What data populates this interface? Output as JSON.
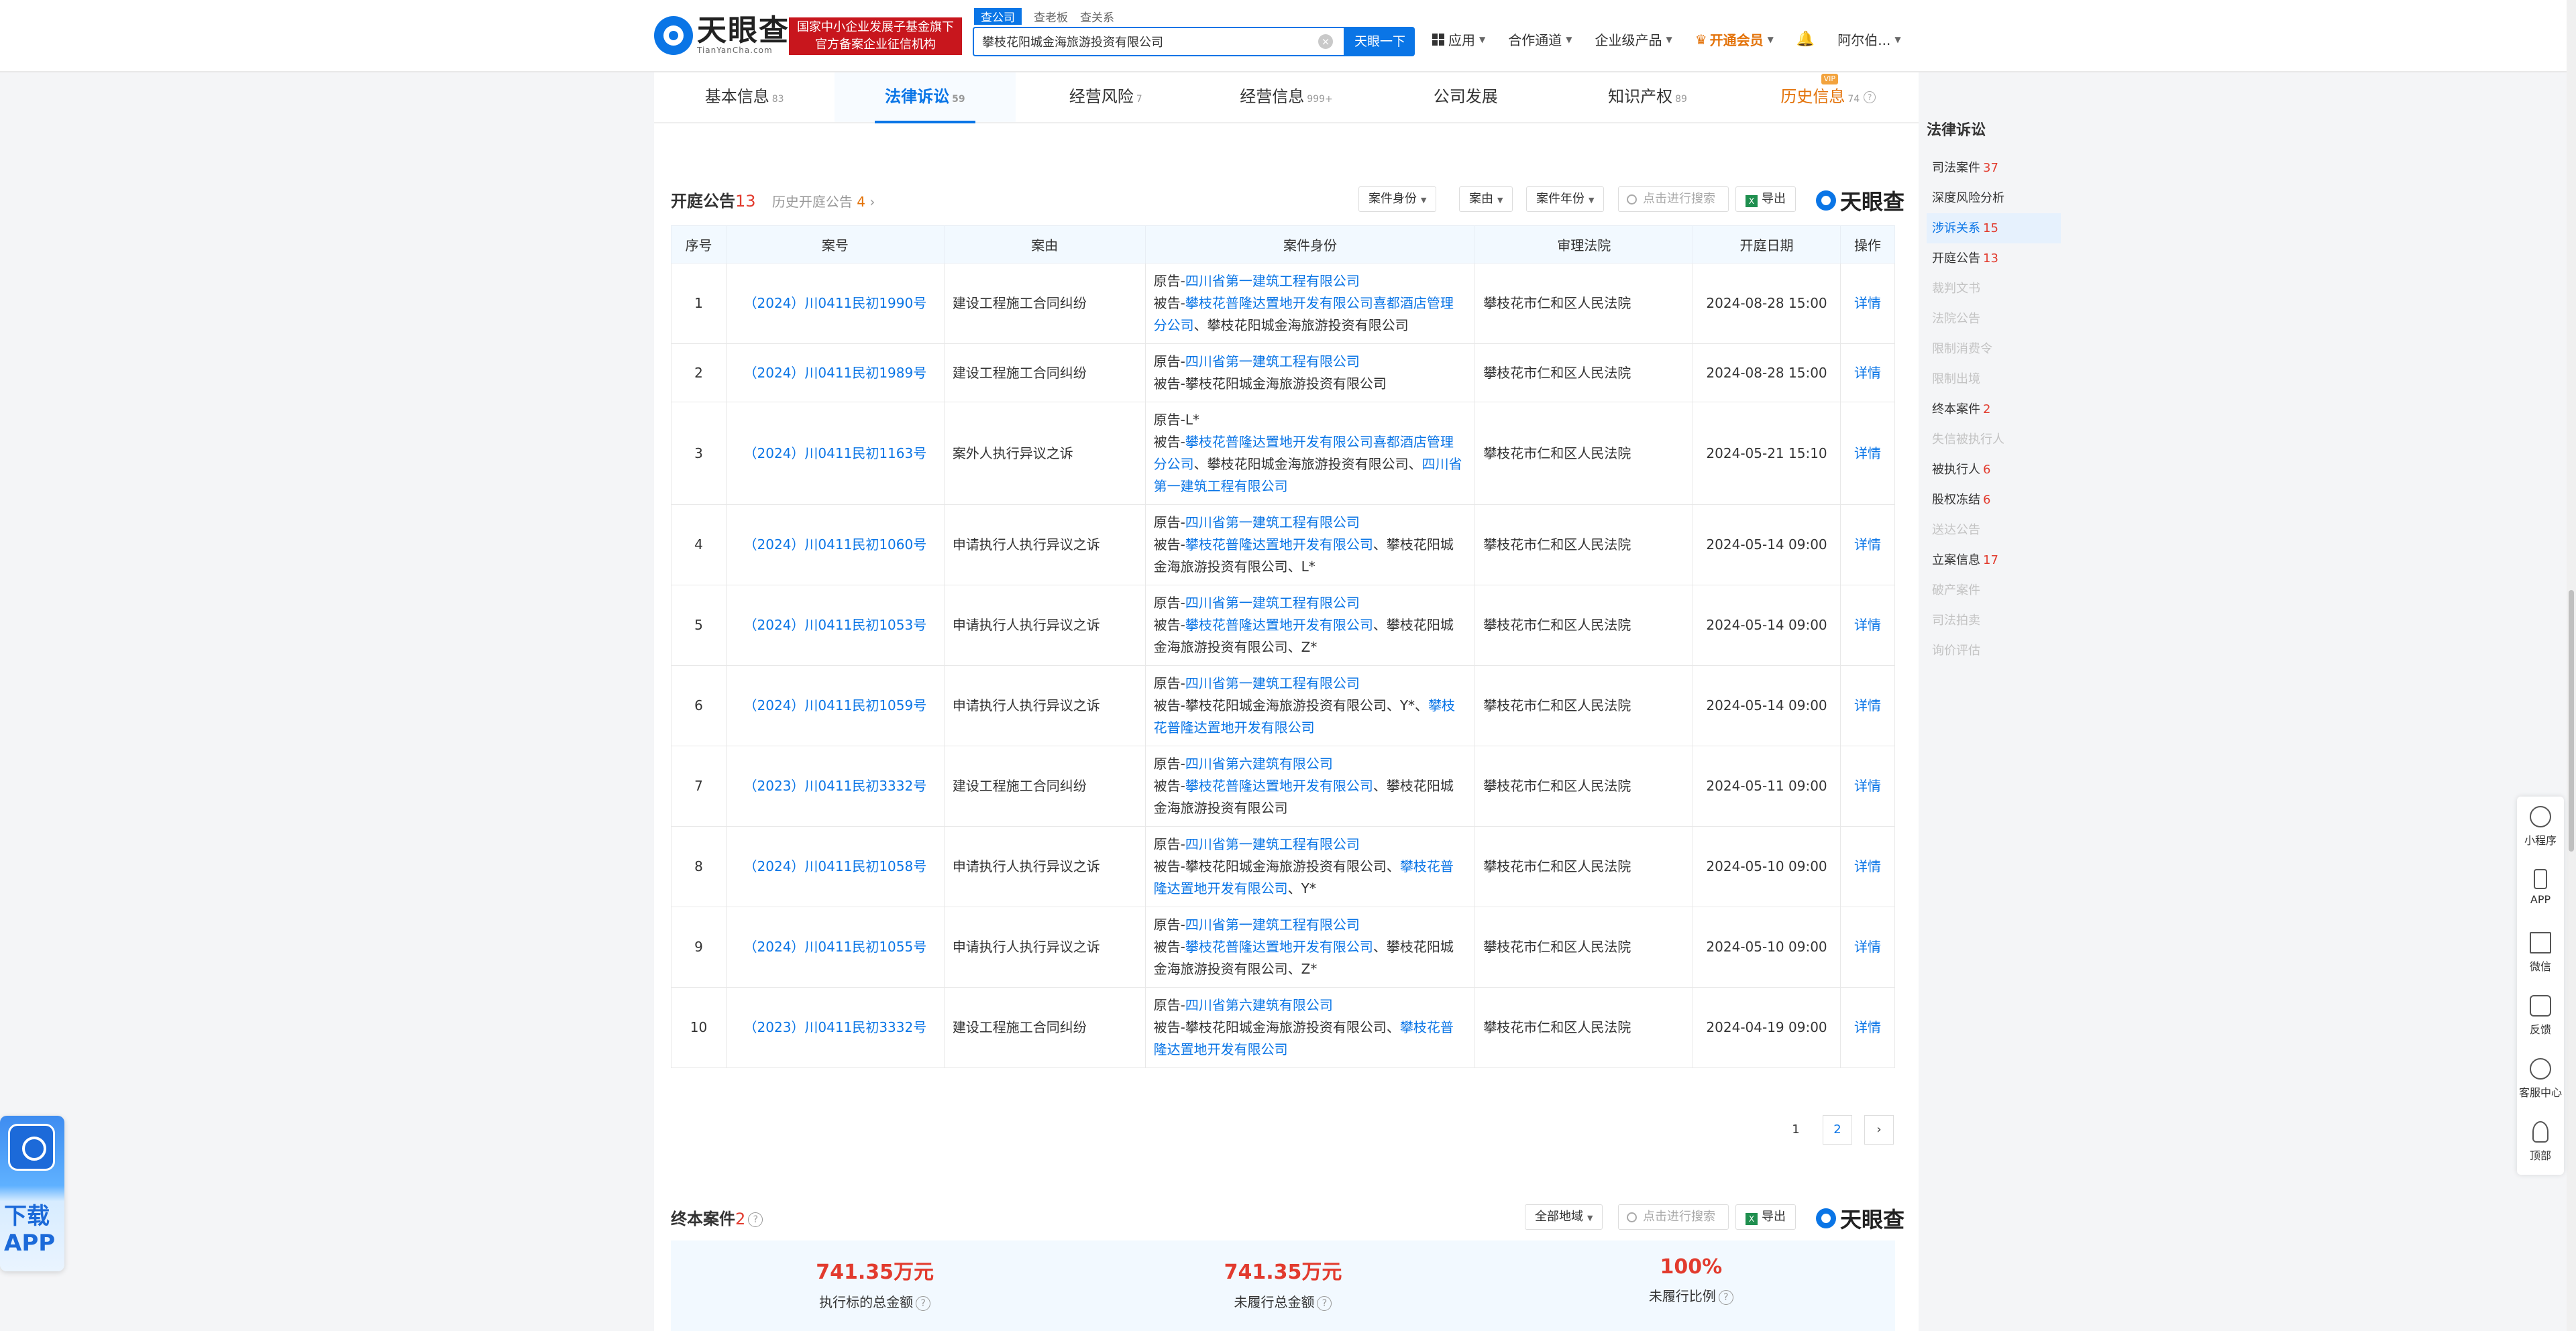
{
  "header": {
    "logo_cn": "天眼查",
    "logo_en": "TianYanCha.com",
    "badge_line1": "国家中小企业发展子基金旗下",
    "badge_line2": "官方备案企业征信机构",
    "search_tabs": [
      "查公司",
      "查老板",
      "查关系"
    ],
    "search_value": "攀枝花阳城金海旅游投资有限公司",
    "search_button": "天眼一下",
    "nav": {
      "apps": "应用",
      "channel": "合作通道",
      "enterprise": "企业级产品",
      "vip": "开通会员",
      "user": "阿尔伯..."
    }
  },
  "tabs": [
    {
      "label": "基本信息",
      "count": "83"
    },
    {
      "label": "法律诉讼",
      "count": "59"
    },
    {
      "label": "经营风险",
      "count": "7"
    },
    {
      "label": "经营信息",
      "count": "999+"
    },
    {
      "label": "公司发展",
      "count": ""
    },
    {
      "label": "知识产权",
      "count": "89"
    },
    {
      "label": "历史信息",
      "count": "74",
      "tag": "VIP"
    }
  ],
  "court": {
    "title": "开庭公告",
    "count": "13",
    "history_label": "历史开庭公告",
    "history_count": "4",
    "filters": [
      "案件身份",
      "案由",
      "案件年份"
    ],
    "search_placeholder": "点击进行搜索",
    "export": "导出",
    "brand": "天眼查",
    "columns": [
      "序号",
      "案号",
      "案由",
      "案件身份",
      "审理法院",
      "开庭日期",
      "操作"
    ],
    "rows": [
      {
        "no": "1",
        "case": "（2024）川0411民初1990号",
        "reason": "建设工程施工合同纠纷",
        "plaintiff": "四川省第一建筑工程有限公司",
        "defendant": [
          {
            "t": "攀枝花普隆达置地开发有限公司喜都酒店管理分公司",
            "link": true
          },
          {
            "t": "、攀枝花阳城金海旅游投资有限公司",
            "link": false
          }
        ],
        "court": "攀枝花市仁和区人民法院",
        "date": "2024-08-28 15:00",
        "op": "详情"
      },
      {
        "no": "2",
        "case": "（2024）川0411民初1989号",
        "reason": "建设工程施工合同纠纷",
        "plaintiff": "四川省第一建筑工程有限公司",
        "defendant": [
          {
            "t": "攀枝花阳城金海旅游投资有限公司",
            "link": false
          }
        ],
        "court": "攀枝花市仁和区人民法院",
        "date": "2024-08-28 15:00",
        "op": "详情"
      },
      {
        "no": "3",
        "case": "（2024）川0411民初1163号",
        "reason": "案外人执行异议之诉",
        "plaintiff_plain": "L*",
        "defendant": [
          {
            "t": "攀枝花普隆达置地开发有限公司喜都酒店管理分公司",
            "link": true
          },
          {
            "t": "、攀枝花阳城金海旅游投资有限公司、",
            "link": false
          },
          {
            "t": "四川省第一建筑工程有限公司",
            "link": true
          }
        ],
        "court": "攀枝花市仁和区人民法院",
        "date": "2024-05-21 15:10",
        "op": "详情"
      },
      {
        "no": "4",
        "case": "（2024）川0411民初1060号",
        "reason": "申请执行人执行异议之诉",
        "plaintiff": "四川省第一建筑工程有限公司",
        "defendant": [
          {
            "t": "攀枝花普隆达置地开发有限公司",
            "link": true
          },
          {
            "t": "、攀枝花阳城金海旅游投资有限公司、L*",
            "link": false
          }
        ],
        "court": "攀枝花市仁和区人民法院",
        "date": "2024-05-14 09:00",
        "op": "详情"
      },
      {
        "no": "5",
        "case": "（2024）川0411民初1053号",
        "reason": "申请执行人执行异议之诉",
        "plaintiff": "四川省第一建筑工程有限公司",
        "defendant": [
          {
            "t": "攀枝花普隆达置地开发有限公司",
            "link": true
          },
          {
            "t": "、攀枝花阳城金海旅游投资有限公司、Z*",
            "link": false
          }
        ],
        "court": "攀枝花市仁和区人民法院",
        "date": "2024-05-14 09:00",
        "op": "详情"
      },
      {
        "no": "6",
        "case": "（2024）川0411民初1059号",
        "reason": "申请执行人执行异议之诉",
        "plaintiff": "四川省第一建筑工程有限公司",
        "defendant": [
          {
            "t": "攀枝花阳城金海旅游投资有限公司、Y*、",
            "link": false
          },
          {
            "t": "攀枝花普隆达置地开发有限公司",
            "link": true
          }
        ],
        "court": "攀枝花市仁和区人民法院",
        "date": "2024-05-14 09:00",
        "op": "详情"
      },
      {
        "no": "7",
        "case": "（2023）川0411民初3332号",
        "reason": "建设工程施工合同纠纷",
        "plaintiff": "四川省第六建筑有限公司",
        "defendant": [
          {
            "t": "攀枝花普隆达置地开发有限公司",
            "link": true
          },
          {
            "t": "、攀枝花阳城金海旅游投资有限公司",
            "link": false
          }
        ],
        "court": "攀枝花市仁和区人民法院",
        "date": "2024-05-11 09:00",
        "op": "详情"
      },
      {
        "no": "8",
        "case": "（2024）川0411民初1058号",
        "reason": "申请执行人执行异议之诉",
        "plaintiff": "四川省第一建筑工程有限公司",
        "defendant": [
          {
            "t": "攀枝花阳城金海旅游投资有限公司、",
            "link": false
          },
          {
            "t": "攀枝花普隆达置地开发有限公司",
            "link": true
          },
          {
            "t": "、Y*",
            "link": false
          }
        ],
        "court": "攀枝花市仁和区人民法院",
        "date": "2024-05-10 09:00",
        "op": "详情"
      },
      {
        "no": "9",
        "case": "（2024）川0411民初1055号",
        "reason": "申请执行人执行异议之诉",
        "plaintiff": "四川省第一建筑工程有限公司",
        "defendant": [
          {
            "t": "攀枝花普隆达置地开发有限公司",
            "link": true
          },
          {
            "t": "、攀枝花阳城金海旅游投资有限公司、Z*",
            "link": false
          }
        ],
        "court": "攀枝花市仁和区人民法院",
        "date": "2024-05-10 09:00",
        "op": "详情"
      },
      {
        "no": "10",
        "case": "（2023）川0411民初3332号",
        "reason": "建设工程施工合同纠纷",
        "plaintiff": "四川省第六建筑有限公司",
        "defendant": [
          {
            "t": "攀枝花阳城金海旅游投资有限公司、",
            "link": false
          },
          {
            "t": "攀枝花普隆达置地开发有限公司",
            "link": true
          }
        ],
        "court": "攀枝花市仁和区人民法院",
        "date": "2024-04-19 09:00",
        "op": "详情"
      }
    ],
    "plaintiff_prefix": "原告-",
    "defendant_prefix": "被告-",
    "pages": [
      "1",
      "2"
    ],
    "next": "›"
  },
  "final": {
    "title": "终本案件",
    "count": "2",
    "region_filter": "全部地域",
    "search_placeholder": "点击进行搜索",
    "export": "导出",
    "brand": "天眼查",
    "stats": [
      {
        "value": "741.35万元",
        "label": "执行标的总金额"
      },
      {
        "value": "741.35万元",
        "label": "未履行总金额"
      },
      {
        "value": "100%",
        "label": "未履行比例"
      }
    ]
  },
  "sidebar": {
    "title": "法律诉讼",
    "items": [
      {
        "label": "司法案件",
        "count": "37",
        "state": "normal"
      },
      {
        "label": "深度风险分析",
        "count": "",
        "state": "normal"
      },
      {
        "label": "涉诉关系",
        "count": "15",
        "state": "active"
      },
      {
        "label": "开庭公告",
        "count": "13",
        "state": "normal"
      },
      {
        "label": "裁判文书",
        "count": "",
        "state": "disabled"
      },
      {
        "label": "法院公告",
        "count": "",
        "state": "disabled"
      },
      {
        "label": "限制消费令",
        "count": "",
        "state": "disabled"
      },
      {
        "label": "限制出境",
        "count": "",
        "state": "disabled"
      },
      {
        "label": "终本案件",
        "count": "2",
        "state": "normal"
      },
      {
        "label": "失信被执行人",
        "count": "",
        "state": "disabled"
      },
      {
        "label": "被执行人",
        "count": "6",
        "state": "normal"
      },
      {
        "label": "股权冻结",
        "count": "6",
        "state": "normal"
      },
      {
        "label": "送达公告",
        "count": "",
        "state": "disabled"
      },
      {
        "label": "立案信息",
        "count": "17",
        "state": "normal"
      },
      {
        "label": "破产案件",
        "count": "",
        "state": "disabled"
      },
      {
        "label": "司法拍卖",
        "count": "",
        "state": "disabled"
      },
      {
        "label": "询价评估",
        "count": "",
        "state": "disabled"
      }
    ]
  },
  "float_tools": [
    "小程序",
    "APP",
    "微信",
    "反馈",
    "客服中心",
    "顶部"
  ],
  "app_promo": {
    "line1": "下载",
    "line2": "APP"
  },
  "colors": {
    "accent": "#0a75e6",
    "alert": "#e23b2e",
    "vip": "#e37209"
  }
}
